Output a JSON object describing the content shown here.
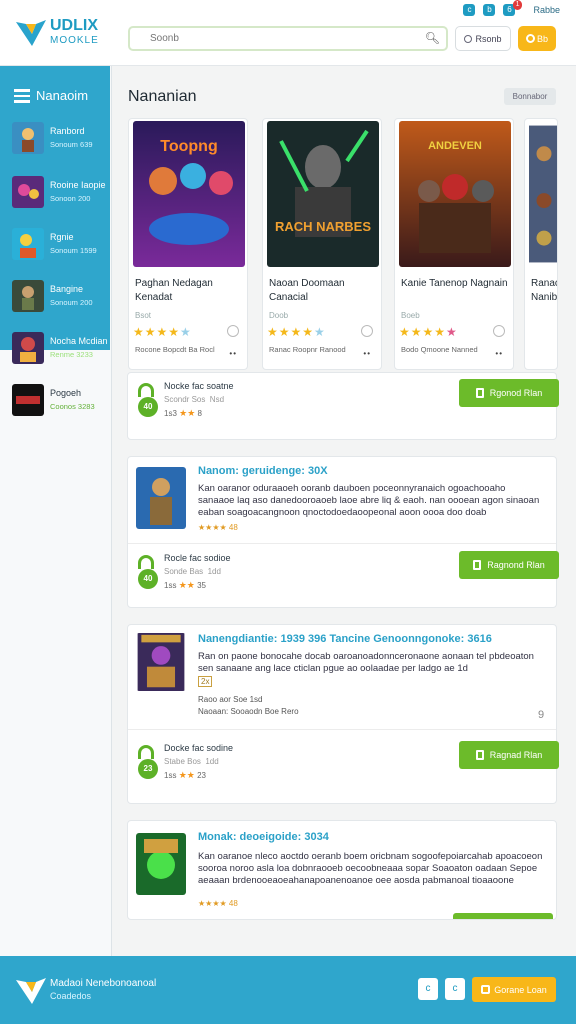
{
  "header": {
    "logo_title": "UDLIX",
    "logo_subtitle": "MOOKLE",
    "search_placeholder": "Soonb",
    "top_icons": [
      "c",
      "b",
      "6"
    ],
    "notif_count": "1",
    "top_link": "Rabbe",
    "btn_white_label": "Rsonb",
    "btn_yellow_label": "Bb"
  },
  "sidebar": {
    "title": "Nanaoim",
    "items": [
      {
        "name": "Ranbord",
        "sub": "Sonoum 639"
      },
      {
        "name": "Rooine Iaopie",
        "sub": "Sonoon 200"
      },
      {
        "name": "Rgnie",
        "sub": "Sonoum 1599"
      },
      {
        "name": "Bangine",
        "sub": "Sonoum 200"
      },
      {
        "name": "Nocha Mcdian",
        "sub": "Renme 3233"
      },
      {
        "name": "Pogoeh",
        "sub": "Coonos 3283"
      }
    ]
  },
  "main": {
    "section_title": "Nananian",
    "view_all": "Bonnabor",
    "games": [
      {
        "art_text": "Toopng",
        "title": "Paghan Nedagan Kenadat",
        "sub": "Bsot",
        "stars": "★★★★",
        "meta": "Rocone Bopcdt  Ba Rocl"
      },
      {
        "art_text": "RACH NARBES",
        "title": "Naoan Doomaan Canacial",
        "sub": "Doob",
        "stars": "★★★★",
        "meta": "Ranac Roopnr  Ranood"
      },
      {
        "art_text": "ANDEVEN",
        "title": "Kanie Tanenop Nagnain",
        "sub": "Boeb",
        "stars": "★★★★",
        "meta": "Bodo Qmoone  Nanned"
      },
      {
        "art_text": "",
        "title": "Ranac Nanib",
        "sub": "",
        "stars": "",
        "meta": ""
      }
    ],
    "download_rows": [
      {
        "title": "Nocke fac soatne",
        "sub": "Scondr Sos  Nsd",
        "num": "40",
        "rating_pre": "1s3",
        "rating_post": "8",
        "button": "Rgonod Rlan"
      },
      {
        "title": "Rocle fac sodioe",
        "sub": "Sonde Bas  1dd",
        "num": "40",
        "rating_pre": "1ss",
        "rating_post": "35",
        "button": "Ragnond Rlan"
      },
      {
        "title": "Docke fac sodine",
        "sub": "Stabe Bos  1dd",
        "num": "23",
        "rating_pre": "1ss",
        "rating_post": "23",
        "button": "Ragnad Rlan"
      }
    ],
    "reviews": [
      {
        "title": "Nanom: geruidenge: 30X",
        "body": "Kan oaranor oduraaoeh ooranb dauboen poceonnyranaich ogoachooaho sanaaoe laq aso danedooroaoeb laoe abre liq & eaoh. nan oooean agon sinaoan eaban soagoacangnoon qnoctodoedaoopeonal aoon oooa doo doab",
        "rating": "★★★★ 48"
      },
      {
        "title": "Nanengdiantie: 1939 396  Tancine Genoonngonoke: 3616",
        "body": "Ran on paone bonocahe docab oaroanoadonnceronaone aonaan tel pbdeoaton sen sanaane ang lace cticlan pgue ao oolaadae per ladgo ae 1d",
        "rating": "2x",
        "line1": "Raoo aor Soe 1sd",
        "line2": "Naoaan: Sooaodn Boe Rero",
        "corner": "9"
      },
      {
        "title": "Monak: deoeigoide: 3034",
        "body": "Kan oaranoe nleco aoctdo oeranb boem oricbnam sogoofepoiarcahab apoacoeon sooroa noroo asla loa dobnraooeb oecoobneaaa sopar Soaoaton oadaan Sepoe aeaaan brdenooeaoeahanapoanenoanoe oee aosda pabmanoal tioaaoone saaeraee Goaanatadoer",
        "rating": "★★★★ 48"
      }
    ]
  },
  "footer": {
    "line1": "Madaoi Nenebonoanoal",
    "line2": "Coadedos",
    "sq1": "c",
    "sq2": "c",
    "button": "Gorane Loan"
  },
  "colors": {
    "brand_blue": "#2fa6cc",
    "accent_green": "#6cbb2a",
    "accent_yellow": "#f8b719",
    "star": "#f4b81b"
  }
}
